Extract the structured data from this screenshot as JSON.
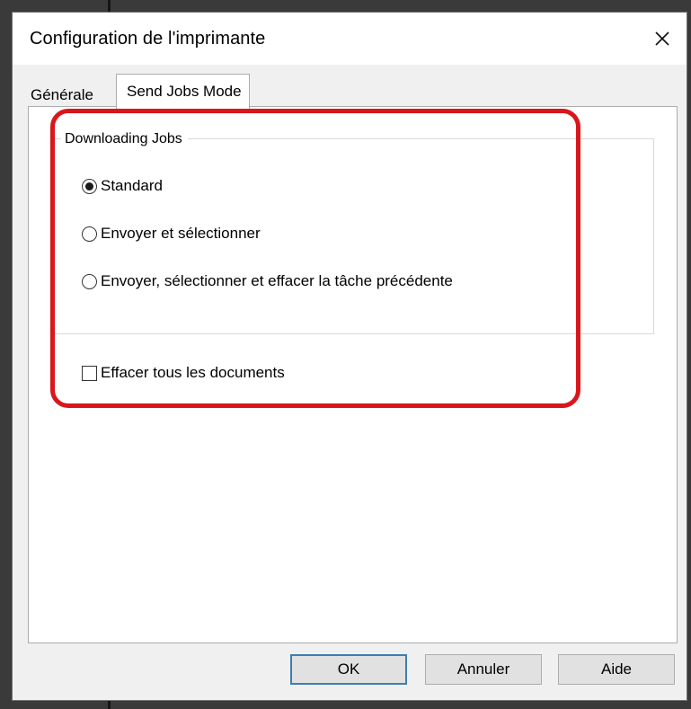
{
  "dialog": {
    "title": "Configuration de l'imprimante",
    "close_icon": "close-icon"
  },
  "tabs": [
    {
      "label": "Générale",
      "selected": false
    },
    {
      "label": "Send Jobs Mode",
      "selected": true
    }
  ],
  "downloading_jobs": {
    "group_label": "Downloading Jobs",
    "options": [
      {
        "label": "Standard",
        "checked": true
      },
      {
        "label": "Envoyer et sélectionner",
        "checked": false
      },
      {
        "label": "Envoyer, sélectionner et effacer la tâche précédente",
        "checked": false
      }
    ]
  },
  "clear_all": {
    "label": "Effacer tous les documents",
    "checked": false
  },
  "buttons": {
    "ok": "OK",
    "cancel": "Annuler",
    "help": "Aide"
  },
  "colors": {
    "highlight": "#d9161c",
    "default_button_border": "#3c7fb1"
  }
}
